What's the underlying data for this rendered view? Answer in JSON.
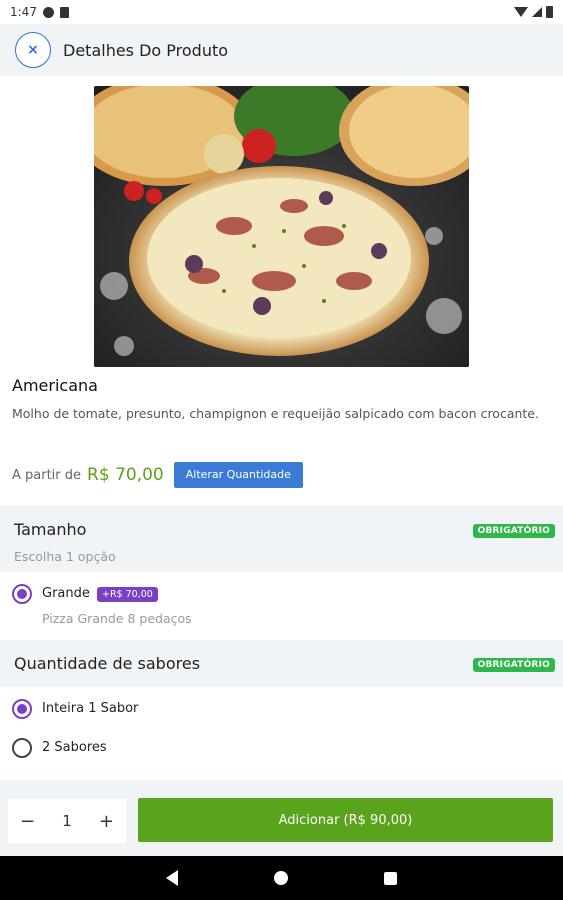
{
  "status_bar": {
    "time": "1:47"
  },
  "header": {
    "close_label": "×",
    "title": "Detalhes Do Produto"
  },
  "product": {
    "image": "pizza-photo",
    "name": "Americana",
    "description": "Molho de tomate, presunto, champignon e requeijão salpicado com bacon crocante.",
    "price_prefix": "A partir de",
    "price": "R$ 70,00",
    "change_quantity_label": "Alterar Quantidade"
  },
  "sections": [
    {
      "title": "Tamanho",
      "subtitle": "Escolha 1 opção",
      "badge": "OBRIGATÓRIO",
      "options": [
        {
          "label": "Grande",
          "price": "+R$ 70,00",
          "description": "Pizza Grande 8 pedaços",
          "selected": true
        }
      ]
    },
    {
      "title": "Quantidade de sabores",
      "badge": "OBRIGATÓRIO",
      "options": [
        {
          "label": "Inteira 1 Sabor",
          "selected": true
        },
        {
          "label": "2 Sabores",
          "selected": false
        }
      ]
    }
  ],
  "footer": {
    "minus": "−",
    "quantity": "1",
    "plus": "+",
    "add_button": "Adicionar (R$ 90,00)"
  },
  "colors": {
    "accent_blue": "#3a7bd5",
    "green": "#5aa31c",
    "badge_green": "#2fb84a",
    "purple": "#7b3fc4"
  }
}
